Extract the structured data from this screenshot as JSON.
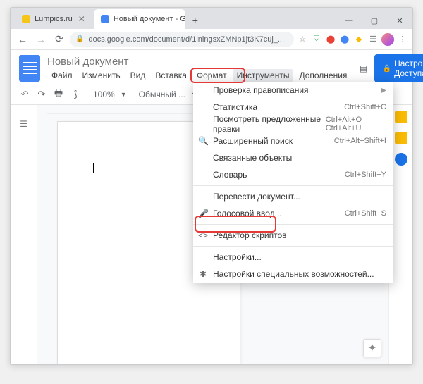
{
  "window": {
    "minimize": "—",
    "maximize": "▢",
    "close": "✕"
  },
  "tabs": [
    {
      "label": "Lumpics.ru",
      "favcolor": "#f5c518",
      "close": "✕"
    },
    {
      "label": "Новый документ - Google Док...",
      "favcolor": "#4285f4",
      "close": "✕"
    }
  ],
  "addrbar": {
    "url": "docs.google.com/document/d/1lningsxZMNp1jt3K7cuj_..."
  },
  "ext_icons": [
    "☆",
    "⛉",
    "⬤",
    "⬤",
    "◆",
    "☰"
  ],
  "doc": {
    "title": "Новый документ",
    "menus": [
      "Файл",
      "Изменить",
      "Вид",
      "Вставка",
      "Формат",
      "Инструменты",
      "Дополнения"
    ],
    "active_menu_index": 5,
    "share": "Настройки Доступа"
  },
  "toolbar": {
    "zoom": "100%",
    "style": "Обычный ..."
  },
  "dropdown": {
    "items": [
      {
        "label": "Проверка правописания",
        "chev": true
      },
      {
        "label": "Статистика",
        "shortcut": "Ctrl+Shift+C"
      },
      {
        "label": "Посмотреть предложенные правки",
        "shortcut": "Ctrl+Alt+O Ctrl+Alt+U"
      },
      {
        "label": "Расширенный поиск",
        "shortcut": "Ctrl+Alt+Shift+I",
        "icon": "🔍"
      },
      {
        "label": "Связанные объекты"
      },
      {
        "label": "Словарь",
        "shortcut": "Ctrl+Shift+Y"
      },
      {
        "sep": true
      },
      {
        "label": "Перевести документ..."
      },
      {
        "label": "Голосовой ввод...",
        "shortcut": "Ctrl+Shift+S",
        "icon": "🎤"
      },
      {
        "sep": true
      },
      {
        "label": "Редактор скриптов",
        "icon": "<>"
      },
      {
        "sep": true
      },
      {
        "label": "Настройки..."
      },
      {
        "label": "Настройки специальных возможностей...",
        "icon": "✱"
      }
    ]
  }
}
